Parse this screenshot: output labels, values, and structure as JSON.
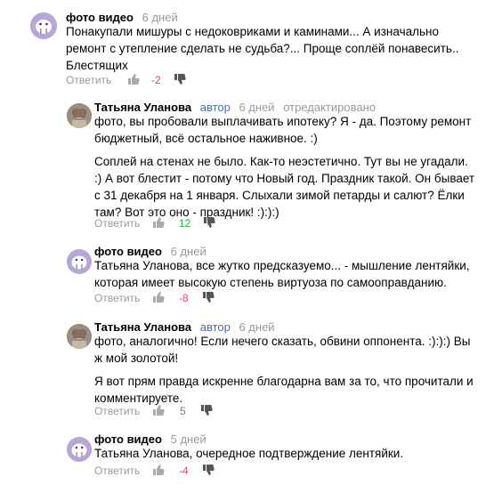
{
  "labels": {
    "reply": "Ответить"
  },
  "colors": {
    "negative": "#d9534f",
    "positive": "#3aa33a",
    "author_badge": "#4a6fb0",
    "muted": "#999999"
  },
  "comments": [
    {
      "author": "фото видео",
      "date": "6 дней",
      "text": [
        "Понакупали мишуры с недоковриками и каминами... А изначально ремонт с утепление сделать не судьба?... Проще соплёй понавесить.. Блестящих"
      ],
      "score": "-2"
    },
    {
      "author": "Татьяна Уланова",
      "badge": "автор",
      "date": "6 дней",
      "edited": "отредактировано",
      "text": [
        "фото, вы пробовали выплачивать ипотеку? Я - да. Поэтому ремонт бюджетный, всё остальное наживное. :)",
        "Соплей на стенах не было. Как-то неэстетично. Тут вы не угадали. :) А вот блестит - потому что Новый год. Праздник такой. Он бывает с 31 декабря на 1 января. Слыхали зимой петарды и салют? Ёлки там? Вот это оно - праздник! :):):)"
      ],
      "score": "12"
    },
    {
      "author": "фото видео",
      "date": "6 дней",
      "text": [
        "Татьяна Уланова, все жутко предсказуемо... - мышление лентяйки, которая имеет высокую степень виртуоза по самооправданию."
      ],
      "score": "-8"
    },
    {
      "author": "Татьяна Уланова",
      "badge": "автор",
      "date": "6 дней",
      "text": [
        "фото, аналогично! Если нечего сказать, обвини оппонента. :):):) Вы ж мой золотой!",
        "Я вот прям правда искренне благодарна вам за то, что прочитали и комментируете."
      ],
      "score": "5"
    },
    {
      "author": "фото видео",
      "date": "5 дней",
      "text": [
        "Татьяна Уланова, очередное подтверждение лентяйки."
      ],
      "score": "-4"
    }
  ]
}
